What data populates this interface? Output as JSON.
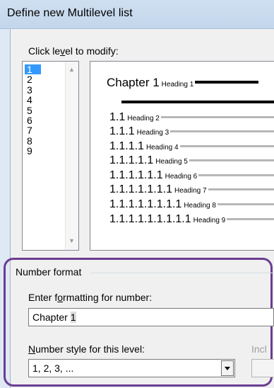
{
  "window": {
    "title": "Define new Multilevel list"
  },
  "level_section": {
    "label_pre": "Click le",
    "label_accel": "v",
    "label_post": "el to modify:",
    "levels": [
      "1",
      "2",
      "3",
      "4",
      "5",
      "6",
      "7",
      "8",
      "9"
    ],
    "selected_level": "1"
  },
  "preview": {
    "chapter_text": "Chapter 1",
    "chapter_heading": "Heading 1",
    "rows": [
      {
        "num": "1.1",
        "heading": "Heading 2"
      },
      {
        "num": "1.1.1",
        "heading": "Heading 3"
      },
      {
        "num": "1.1.1.1",
        "heading": "Heading 4"
      },
      {
        "num": "1.1.1.1.1",
        "heading": "Heading 5"
      },
      {
        "num": "1.1.1.1.1.1",
        "heading": "Heading 6"
      },
      {
        "num": "1.1.1.1.1.1.1",
        "heading": "Heading 7"
      },
      {
        "num": "1.1.1.1.1.1.1.1",
        "heading": "Heading 8"
      },
      {
        "num": "1.1.1.1.1.1.1.1.1",
        "heading": "Heading 9"
      }
    ]
  },
  "number_format": {
    "group_label": "Number format",
    "enter_label_pre": "Enter f",
    "enter_label_accel": "o",
    "enter_label_post": "rmatting for number:",
    "format_text": "Chapter ",
    "format_field": "1",
    "style_label_accel": "N",
    "style_label_post": "umber style for this level:",
    "style_value": "1, 2, 3, ...",
    "include_label": "Incl"
  },
  "colors": {
    "highlight": "#6a3d91",
    "selection": "#3399ff"
  }
}
